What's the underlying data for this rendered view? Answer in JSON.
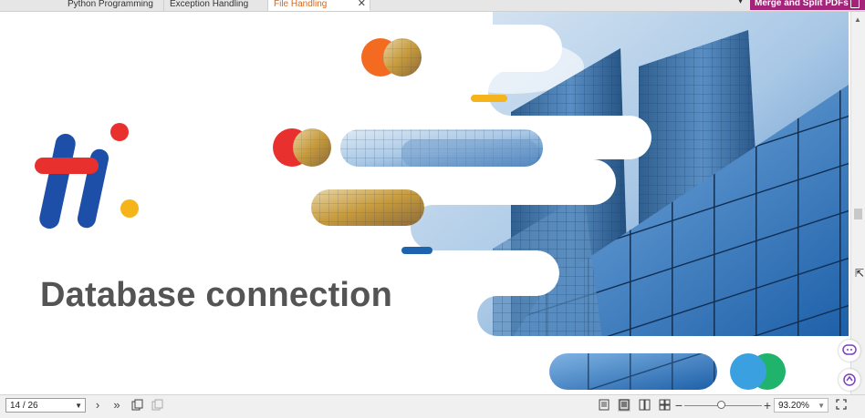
{
  "tabs": [
    {
      "label": "Python Programming",
      "active": false
    },
    {
      "label": "Exception Handling",
      "active": false
    },
    {
      "label": "File Handling",
      "active": true
    }
  ],
  "tab_close_glyph": "✕",
  "merge_button": {
    "label": "Merge and Split PDFs",
    "color": "#a4247a"
  },
  "slide": {
    "title": "Database connection",
    "logo": {
      "name": "hi-logo",
      "colors": {
        "red": "#e8312f",
        "blue": "#1e4fa8",
        "yellow": "#f4b41a"
      }
    }
  },
  "statusbar": {
    "page_indicator": "14 / 26",
    "zoom_value": "93.20%",
    "zoom_level": 0.44,
    "icons": [
      "next-page-icon",
      "last-page-icon",
      "rotate-icon",
      "extract-icon",
      "single-page-view-icon",
      "continuous-view-icon",
      "two-page-view-icon",
      "two-page-continuous-icon",
      "zoom-out-icon",
      "zoom-in-icon",
      "fullscreen-icon"
    ]
  },
  "side_buttons": [
    "chat-icon",
    "ai-assistant-icon"
  ]
}
